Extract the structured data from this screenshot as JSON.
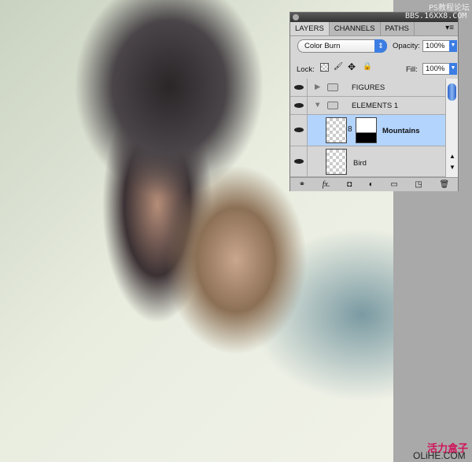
{
  "watermarks": {
    "top_line1": "PS教程论坛",
    "top_line2": "BBS.16XX8.COM",
    "bottom_line1": "活力盒子",
    "bottom_line2": "OLiHE.COM"
  },
  "panel": {
    "tabs": [
      {
        "label": "LAYERS",
        "active": true
      },
      {
        "label": "CHANNELS"
      },
      {
        "label": "PATHS"
      }
    ],
    "blend_mode": "Color Burn",
    "opacity_label": "Opacity:",
    "opacity": "100%",
    "lock_label": "Lock:",
    "fill_label": "Fill:",
    "fill": "100%",
    "layers": [
      {
        "name": "FIGURES",
        "type": "group",
        "expanded": false,
        "visible": true
      },
      {
        "name": "ELEMENTS 1",
        "type": "group",
        "expanded": true,
        "visible": true
      },
      {
        "name": "Mountains",
        "type": "layer",
        "has_mask": true,
        "selected": true,
        "visible": true
      },
      {
        "name": "Bird",
        "type": "layer",
        "visible": true
      }
    ],
    "selection_color": "#b3d4fc"
  }
}
